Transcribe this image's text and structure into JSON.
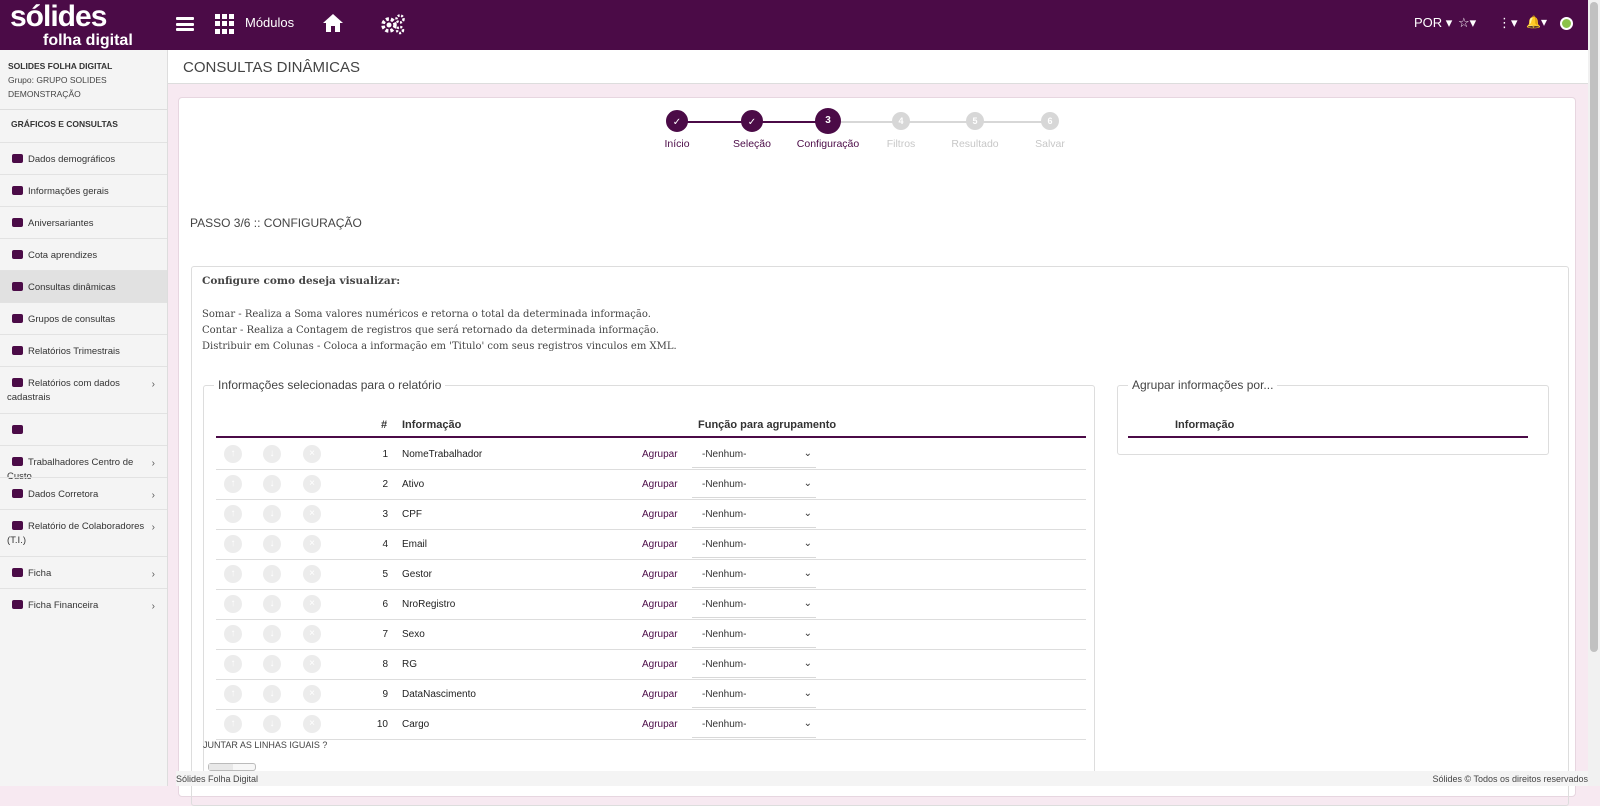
{
  "topbar": {
    "logo_line1": "sólides",
    "logo_line2": "folha digital",
    "modules_label": "Módulos",
    "lang": "POR ▾",
    "star": "☆▾",
    "kebab": "⋮▾",
    "bell": "🔔▾",
    "icons": [
      "menu-icon",
      "grid-icon",
      "home-icon",
      "gears-icon",
      "star-icon",
      "kebab-icon",
      "bell-icon",
      "globe-icon"
    ]
  },
  "sidebar": {
    "company": "SOLIDES FOLHA DIGITAL",
    "group": "Grupo: GRUPO SOLIDES DEMONSTRAÇÃO",
    "section": "GRÁFICOS E CONSULTAS",
    "items": [
      {
        "label": "Dados demográficos",
        "icon": "pie-icon",
        "chevron": ""
      },
      {
        "label": "Informações gerais",
        "icon": "id-card-icon",
        "chevron": ""
      },
      {
        "label": "Aniversariantes",
        "icon": "smile-icon",
        "chevron": ""
      },
      {
        "label": "Cota aprendizes",
        "icon": "graduation-icon",
        "chevron": ""
      },
      {
        "label": "Consultas dinâmicas",
        "icon": "table-icon",
        "chevron": ""
      },
      {
        "label": "Grupos de consultas",
        "icon": "layers-icon",
        "chevron": ""
      },
      {
        "label": "Relatórios Trimestrais",
        "icon": "print-icon",
        "chevron": ""
      },
      {
        "label": "Relatórios com dados cadastrais",
        "icon": "print-icon",
        "chevron": "›"
      },
      {
        "label": "",
        "icon": "print-icon",
        "chevron": ""
      },
      {
        "label": "Trabalhadores Centro de Custo",
        "icon": "print-icon",
        "chevron": "›"
      },
      {
        "label": "Dados Corretora",
        "icon": "print-icon",
        "chevron": "›"
      },
      {
        "label": "Relatório de Colaboradores (T.I.)",
        "icon": "print-icon",
        "chevron": "›"
      },
      {
        "label": "Ficha",
        "icon": "print-icon",
        "chevron": "›"
      },
      {
        "label": "Ficha Financeira",
        "icon": "print-icon",
        "chevron": "›"
      }
    ]
  },
  "page": {
    "title": "CONSULTAS DINÂMICAS",
    "step_heading": "PASSO 3/6 :: CONFIGURAÇÃO"
  },
  "steps": [
    {
      "label": "Início",
      "num": "✓",
      "state": "done"
    },
    {
      "label": "Seleção",
      "num": "✓",
      "state": "done"
    },
    {
      "label": "Configuração",
      "num": "3",
      "state": "current"
    },
    {
      "label": "Filtros",
      "num": "4",
      "state": "todo"
    },
    {
      "label": "Resultado",
      "num": "5",
      "state": "todo"
    },
    {
      "label": "Salvar",
      "num": "6",
      "state": "todo"
    }
  ],
  "config": {
    "title": "Configure como deseja visualizar:",
    "desc": [
      "Somar - Realiza a Soma valores numéricos e retorna o total da determinada informação.",
      "Contar - Realiza a Contagem de registros que será retornado da determinada informação.",
      "Distribuir em Colunas - Coloca a informação em 'Titulo' com seus registros vinculos em XML."
    ]
  },
  "selected": {
    "legend": "Informações selecionadas para o relatório",
    "col_num": "#",
    "col_info": "Informação",
    "col_func": "Função para agrupamento",
    "rows": [
      {
        "num": "1",
        "info": "NomeTrabalhador",
        "action": "Agrupar",
        "func": "-Nenhum-"
      },
      {
        "num": "2",
        "info": "Ativo",
        "action": "Agrupar",
        "func": "-Nenhum-"
      },
      {
        "num": "3",
        "info": "CPF",
        "action": "Agrupar",
        "func": "-Nenhum-"
      },
      {
        "num": "4",
        "info": "Email",
        "action": "Agrupar",
        "func": "-Nenhum-"
      },
      {
        "num": "5",
        "info": "Gestor",
        "action": "Agrupar",
        "func": "-Nenhum-"
      },
      {
        "num": "6",
        "info": "NroRegistro",
        "action": "Agrupar",
        "func": "-Nenhum-"
      },
      {
        "num": "7",
        "info": "Sexo",
        "action": "Agrupar",
        "func": "-Nenhum-"
      },
      {
        "num": "8",
        "info": "RG",
        "action": "Agrupar",
        "func": "-Nenhum-"
      },
      {
        "num": "9",
        "info": "DataNascimento",
        "action": "Agrupar",
        "func": "-Nenhum-"
      },
      {
        "num": "10",
        "info": "Cargo",
        "action": "Agrupar",
        "func": "-Nenhum-"
      }
    ]
  },
  "group": {
    "legend": "Agrupar informações por...",
    "col_info": "Informação"
  },
  "juntar_label": "JUNTAR AS LINHAS IGUAIS ?",
  "footer": {
    "left": "Sólides Folha Digital",
    "right": "Sólides © Todos os direitos reservados"
  },
  "colors": {
    "brand": "#4b0b47",
    "background": "#f7e9f1"
  }
}
